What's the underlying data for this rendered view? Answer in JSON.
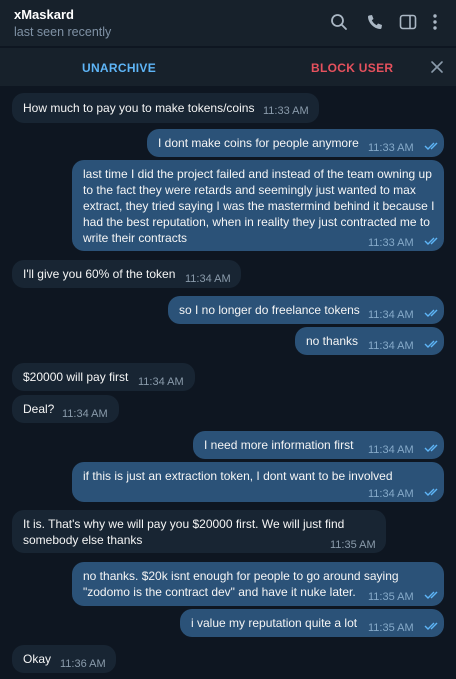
{
  "header": {
    "name": "xMaskard",
    "status": "last seen recently"
  },
  "actions": {
    "unarchive": "UNARCHIVE",
    "block": "BLOCK USER"
  },
  "messages": [
    {
      "dir": "in",
      "text": "How much to pay you to make tokens/coins",
      "time": "11:33 AM"
    },
    {
      "dir": "out",
      "text": "I dont make coins for people anymore",
      "time": "11:33 AM"
    },
    {
      "dir": "out",
      "text": "last time I did the project failed and instead of the team owning up to the fact they were retards and seemingly just wanted to max extract, they tried saying I was the mastermind behind it because I had the best reputation, when in reality they just contracted me to write their contracts",
      "time": "11:33 AM"
    },
    {
      "dir": "in",
      "text": "I'll give you 60% of the token",
      "time": "11:34 AM"
    },
    {
      "dir": "out",
      "text": "so I no longer do freelance tokens",
      "time": "11:34 AM"
    },
    {
      "dir": "out",
      "text": "no thanks",
      "time": "11:34 AM"
    },
    {
      "dir": "in",
      "text": "$20000 will pay first",
      "time": "11:34 AM"
    },
    {
      "dir": "in",
      "text": "Deal?",
      "time": "11:34 AM"
    },
    {
      "dir": "out",
      "text": "I need more information first",
      "time": "11:34 AM"
    },
    {
      "dir": "out",
      "text": "if this is just an extraction token, I dont want to be involved",
      "time": "11:34 AM"
    },
    {
      "dir": "in",
      "text": "It is. That's why we will pay you $20000 first. We will just find somebody else thanks",
      "time": "11:35 AM"
    },
    {
      "dir": "out",
      "text": "no thanks. $20k isnt enough for people to go around saying \"zodomo is the contract dev\" and have it nuke later.",
      "time": "11:35 AM"
    },
    {
      "dir": "out",
      "text": "i value my reputation quite a lot",
      "time": "11:35 AM"
    },
    {
      "dir": "in",
      "text": "Okay",
      "time": "11:36 AM"
    }
  ],
  "colors": {
    "background": "#0e1621",
    "header": "#17212b",
    "incoming_bubble": "#182533",
    "outgoing_bubble": "#2b5278",
    "accent": "#5eb5f7",
    "danger": "#e5515d"
  },
  "icons": [
    "search-icon",
    "phone-icon",
    "sidebar-panel-icon",
    "more-vertical-icon",
    "close-icon",
    "double-check-icon"
  ]
}
